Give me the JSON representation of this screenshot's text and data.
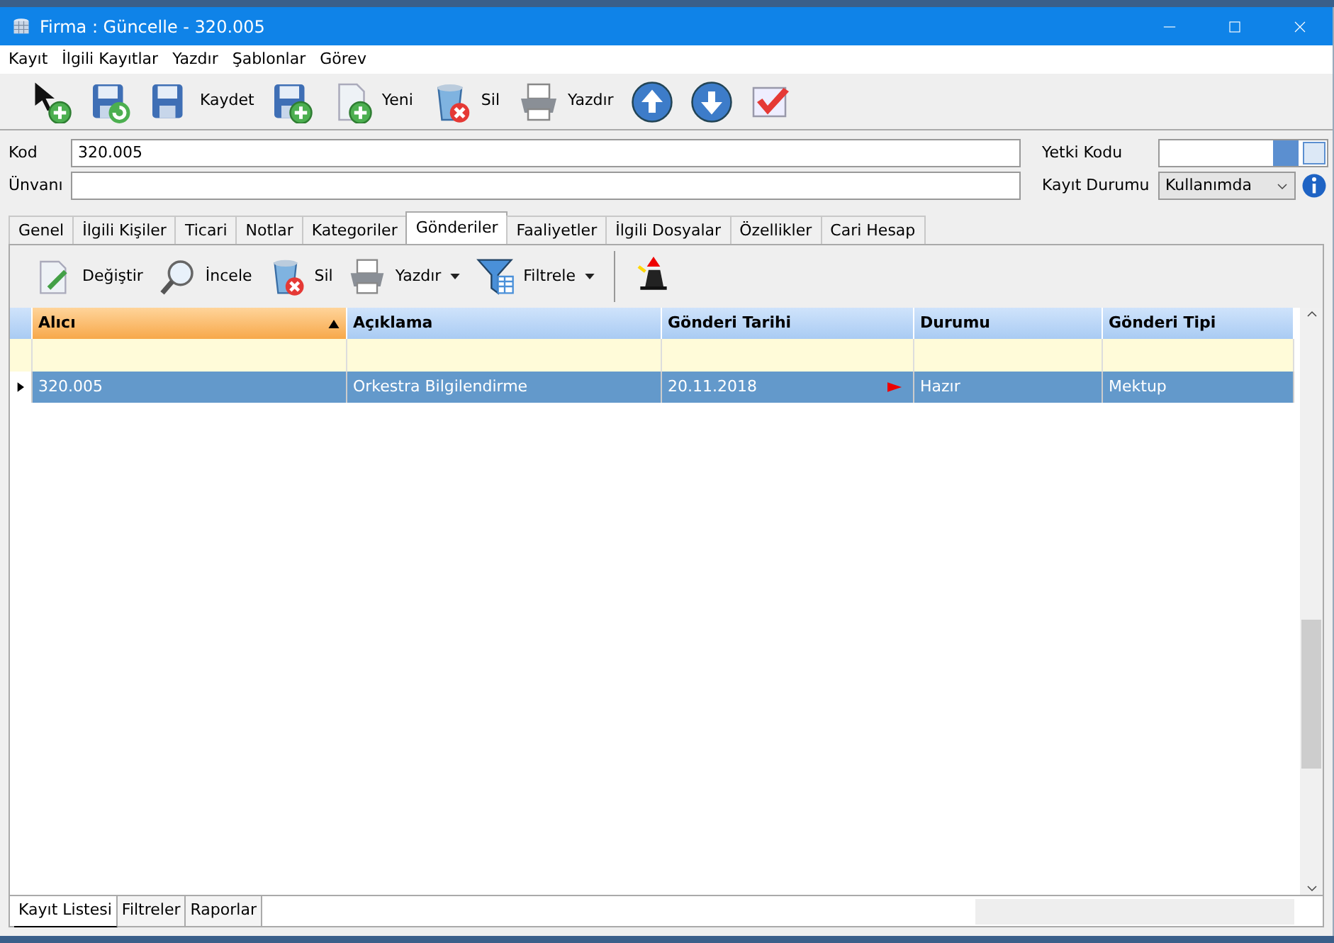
{
  "window": {
    "title": "Firma : Güncelle - 320.005"
  },
  "menu": [
    "Kayıt",
    "İlgili Kayıtlar",
    "Yazdır",
    "Şablonlar",
    "Görev"
  ],
  "toolbar": [
    {
      "kind": "add-pointer"
    },
    {
      "kind": "save-undo"
    },
    {
      "kind": "save",
      "label": "Kaydet"
    },
    {
      "kind": "save-add"
    },
    {
      "kind": "new",
      "label": "Yeni"
    },
    {
      "kind": "delete",
      "label": "Sil"
    },
    {
      "kind": "print",
      "label": "Yazdır"
    },
    {
      "kind": "up"
    },
    {
      "kind": "down"
    },
    {
      "kind": "check"
    }
  ],
  "form": {
    "kod_label": "Kod",
    "kod": "320.005",
    "unvan_label": "Ünvanı",
    "yetki_label": "Yetki Kodu",
    "durum_label": "Kayıt Durumu",
    "durum": "Kullanımda"
  },
  "tabs": [
    {
      "label": "Genel",
      "selected": false
    },
    {
      "label": "İlgili Kişiler",
      "selected": false
    },
    {
      "label": "Ticari",
      "selected": false
    },
    {
      "label": "Notlar",
      "selected": false
    },
    {
      "label": "Kategoriler",
      "selected": false
    },
    {
      "label": "Gönderiler",
      "selected": true
    },
    {
      "label": "Faaliyetler",
      "selected": false
    },
    {
      "label": "İlgili Dosyalar",
      "selected": false
    },
    {
      "label": "Özellikler",
      "selected": false
    },
    {
      "label": "Cari Hesap",
      "selected": false
    }
  ],
  "subtoolbar": [
    {
      "kind": "edit",
      "label": "Değiştir",
      "dropdown": false
    },
    {
      "kind": "inspect",
      "label": "İncele",
      "dropdown": false
    },
    {
      "kind": "delete",
      "label": "Sil",
      "dropdown": false
    },
    {
      "kind": "print",
      "label": "Yazdır",
      "dropdown": true
    },
    {
      "kind": "filter",
      "label": "Filtrele",
      "dropdown": true
    },
    {
      "kind": "wizard",
      "dropdown": false
    }
  ],
  "table": {
    "columns": [
      {
        "label": "Alıcı",
        "sorted": true
      },
      {
        "label": "Açıklama",
        "sorted": false
      },
      {
        "label": "Gönderi Tarihi",
        "sorted": false
      },
      {
        "label": "Durumu",
        "sorted": false
      },
      {
        "label": "Gönderi Tipi",
        "sorted": false
      }
    ],
    "rows": [
      {
        "cells": [
          "320.005",
          "Orkestra Bilgilendirme",
          "20.11.2018",
          "Hazır",
          "Mektup"
        ],
        "selected": true,
        "flagged": true
      }
    ]
  },
  "bottom_tabs": [
    {
      "label": "Kayıt Listesi",
      "selected": true
    },
    {
      "label": "Filtreler",
      "selected": false
    },
    {
      "label": "Raporlar",
      "selected": false
    }
  ]
}
